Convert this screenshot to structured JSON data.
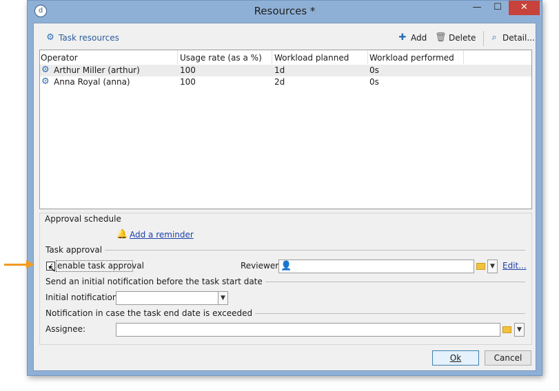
{
  "window": {
    "title": "Resources *",
    "app_icon_glyph": "d",
    "minimize_glyph": "—",
    "maximize_glyph": "☐",
    "close_glyph": "✕"
  },
  "toolbar": {
    "title": "Task resources",
    "add_label": "Add",
    "delete_label": "Delete",
    "detail_label": "Detail..."
  },
  "grid": {
    "columns": [
      "Operator",
      "Usage rate (as a %)",
      "Workload planned",
      "Workload performed"
    ],
    "rows": [
      {
        "operator": "Arthur Miller (arthur)",
        "usage": "100",
        "planned": "1d",
        "performed": "0s"
      },
      {
        "operator": "Anna Royal (anna)",
        "usage": "100",
        "planned": "2d",
        "performed": "0s"
      }
    ]
  },
  "approval_schedule": {
    "label": "Approval schedule",
    "add_reminder": "Add a reminder"
  },
  "task_approval": {
    "label": "Task approval",
    "enable_label": "enable task approval",
    "enabled": true,
    "check_glyph": "✓",
    "reviewer_label": "Reviewer:",
    "reviewer_value": "",
    "edit_link": "Edit..."
  },
  "initial_notification": {
    "section_label": "Send an initial notification before the task start date",
    "field_label": "Initial notification:",
    "value": ""
  },
  "overdue_notification": {
    "section_label": "Notification in case the task end date is exceeded",
    "assignee_label": "Assignee:",
    "value": ""
  },
  "buttons": {
    "ok": "Ok",
    "cancel": "Cancel"
  },
  "colors": {
    "accent_arrow": "#f39a1e",
    "close_button": "#c7423a",
    "link": "#1b3fa8"
  }
}
